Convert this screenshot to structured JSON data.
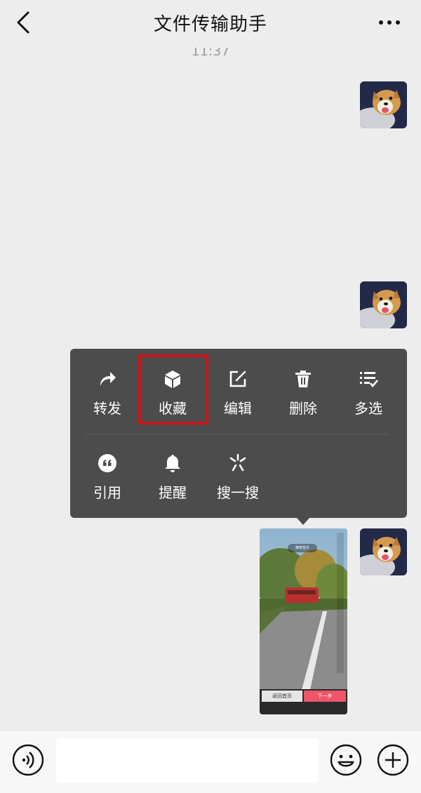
{
  "header": {
    "title": "文件传输助手",
    "back_icon": "chevron-left-icon",
    "more_icon": "ellipsis-icon"
  },
  "chat": {
    "timestamp": "11:37",
    "messages": [
      {
        "type": "avatar-only",
        "sender": "me"
      },
      {
        "type": "avatar-only",
        "sender": "me"
      },
      {
        "type": "video-screenshot",
        "sender": "me",
        "left_button": "返回首页",
        "right_button": "下一步",
        "pill_text": "推荐音乐"
      }
    ]
  },
  "context_menu": {
    "row1": [
      {
        "label": "转发",
        "icon": "forward-icon"
      },
      {
        "label": "收藏",
        "icon": "cube-icon"
      },
      {
        "label": "编辑",
        "icon": "edit-icon"
      },
      {
        "label": "删除",
        "icon": "trash-icon"
      },
      {
        "label": "多选",
        "icon": "multi-select-icon"
      }
    ],
    "row2": [
      {
        "label": "引用",
        "icon": "quote-icon"
      },
      {
        "label": "提醒",
        "icon": "bell-icon"
      },
      {
        "label": "搜一搜",
        "icon": "search-spark-icon"
      }
    ],
    "highlighted": "收藏",
    "highlight_color": "#c8161d"
  },
  "input_bar": {
    "voice_icon": "voice-icon",
    "emoji_icon": "emoji-icon",
    "plus_icon": "plus-icon",
    "placeholder": ""
  },
  "colors": {
    "background": "#ededed",
    "menu_background": "#4c4c4c"
  }
}
